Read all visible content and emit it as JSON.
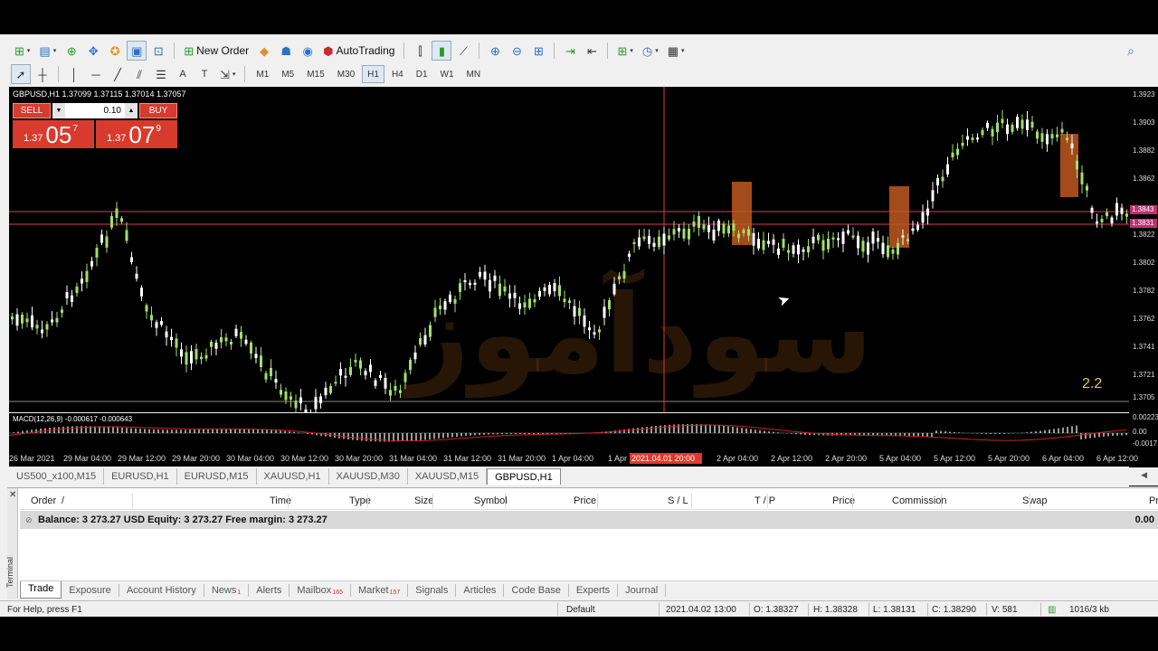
{
  "toolbar": {
    "new_order_label": "New Order",
    "autotrading_label": "AutoTrading",
    "timeframes": [
      "M1",
      "M5",
      "M15",
      "M30",
      "H1",
      "H4",
      "D1",
      "W1",
      "MN"
    ],
    "active_timeframe": "H1"
  },
  "chart": {
    "header": "GBPUSD,H1  1.37099 1.37115 1.37014 1.37057",
    "sell_label": "SELL",
    "buy_label": "BUY",
    "lot": "0.10",
    "sell_price": {
      "prefix": "1.37",
      "big": "05",
      "sup": "7"
    },
    "buy_price": {
      "prefix": "1.37",
      "big": "07",
      "sup": "9"
    },
    "counter": "2.2",
    "watermark": "سودآموز",
    "macd_label": "MACD(12,26,9) -0.000617 -0.000643",
    "price_labels": [
      "1.3923",
      "1.3903",
      "1.3882",
      "1.3862",
      "1.3822",
      "1.3802",
      "1.3782",
      "1.3762",
      "1.3741",
      "1.3721",
      "1.3705"
    ],
    "price_tag_upper": "1.3843",
    "price_tag_lower": "1.3831",
    "macd_axis_labels": [
      "0.00223",
      "0.00",
      "-0.0017"
    ],
    "time_labels": [
      "26 Mar 2021",
      "29 Mar 04:00",
      "29 Mar 12:00",
      "29 Mar 20:00",
      "30 Mar 04:00",
      "30 Mar 12:00",
      "30 Mar 20:00",
      "31 Mar 04:00",
      "31 Mar 12:00",
      "31 Mar 20:00",
      "1 Apr 04:00",
      "1 Apr",
      "2 Apr 04:00",
      "2 Apr 12:00",
      "2 Apr 20:00",
      "5 Apr 04:00",
      "5 Apr 12:00",
      "5 Apr 20:00",
      "6 Apr 04:00",
      "6 Apr 12:00"
    ],
    "time_highlight": "2021.04.01 20:00",
    "colors": {
      "bull": "#9fe06a",
      "bear": "#ffffff",
      "hline": "#d04060",
      "vline": "#e23a2a",
      "rect": "#c0581e",
      "macd_signal": "#d02020",
      "tag": "#c03070"
    }
  },
  "chart_tabs": [
    "US500_x100,M15",
    "EURUSD,H1",
    "EURUSD,M15",
    "XAUUSD,H1",
    "XAUUSD,M30",
    "XAUUSD,M15",
    "GBPUSD,H1"
  ],
  "active_chart_tab": "GBPUSD,H1",
  "terminal": {
    "side_label": "Terminal",
    "columns": [
      "Order",
      "/",
      "Time",
      "Type",
      "Size",
      "Symbol",
      "Price",
      "S / L",
      "T / P",
      "Price",
      "Commission",
      "Swap",
      "Profi"
    ],
    "balance_line": "Balance: 3 273.27 USD  Equity: 3 273.27  Free margin: 3 273.27",
    "balance_profit": "0.00",
    "tabs": [
      {
        "label": "Trade",
        "badge": ""
      },
      {
        "label": "Exposure",
        "badge": ""
      },
      {
        "label": "Account History",
        "badge": ""
      },
      {
        "label": "News",
        "badge": "1"
      },
      {
        "label": "Alerts",
        "badge": ""
      },
      {
        "label": "Mailbox",
        "badge": "165"
      },
      {
        "label": "Market",
        "badge": "157"
      },
      {
        "label": "Signals",
        "badge": ""
      },
      {
        "label": "Articles",
        "badge": ""
      },
      {
        "label": "Code Base",
        "badge": ""
      },
      {
        "label": "Experts",
        "badge": ""
      },
      {
        "label": "Journal",
        "badge": ""
      }
    ],
    "active_tab": "Trade"
  },
  "status": {
    "help": "For Help, press F1",
    "profile": "Default",
    "datetime": "2021.04.02 13:00",
    "open": "O: 1.38327",
    "high": "H: 1.38328",
    "low": "L: 1.38131",
    "close": "C: 1.38290",
    "volume": "V: 581",
    "traffic": "1016/3 kb"
  }
}
